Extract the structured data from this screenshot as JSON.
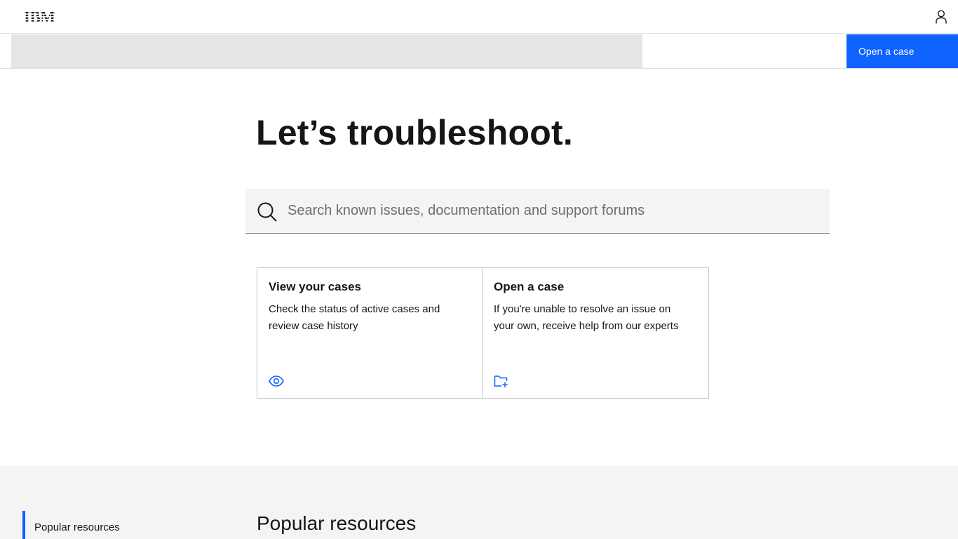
{
  "masthead": {
    "logo_text": "IBM",
    "user_icon": "user-icon"
  },
  "subnav": {
    "cta_label": "Open a case"
  },
  "hero": {
    "title": "Let’s troubleshoot."
  },
  "search": {
    "placeholder": "Search known issues, documentation and support forums",
    "value": "",
    "icon": "search-icon"
  },
  "cards": [
    {
      "title": "View your cases",
      "description": "Check the status of active cases and review case history",
      "icon": "eye-icon"
    },
    {
      "title": "Open a case",
      "description": "If you're unable to resolve an issue on your own, receive help from our experts",
      "icon": "folder-add-icon"
    }
  ],
  "resources": {
    "nav_item": "Popular resources",
    "heading": "Popular resources"
  },
  "colors": {
    "accent": "#0f62fe",
    "text": "#161616",
    "surface": "#f4f4f4"
  }
}
